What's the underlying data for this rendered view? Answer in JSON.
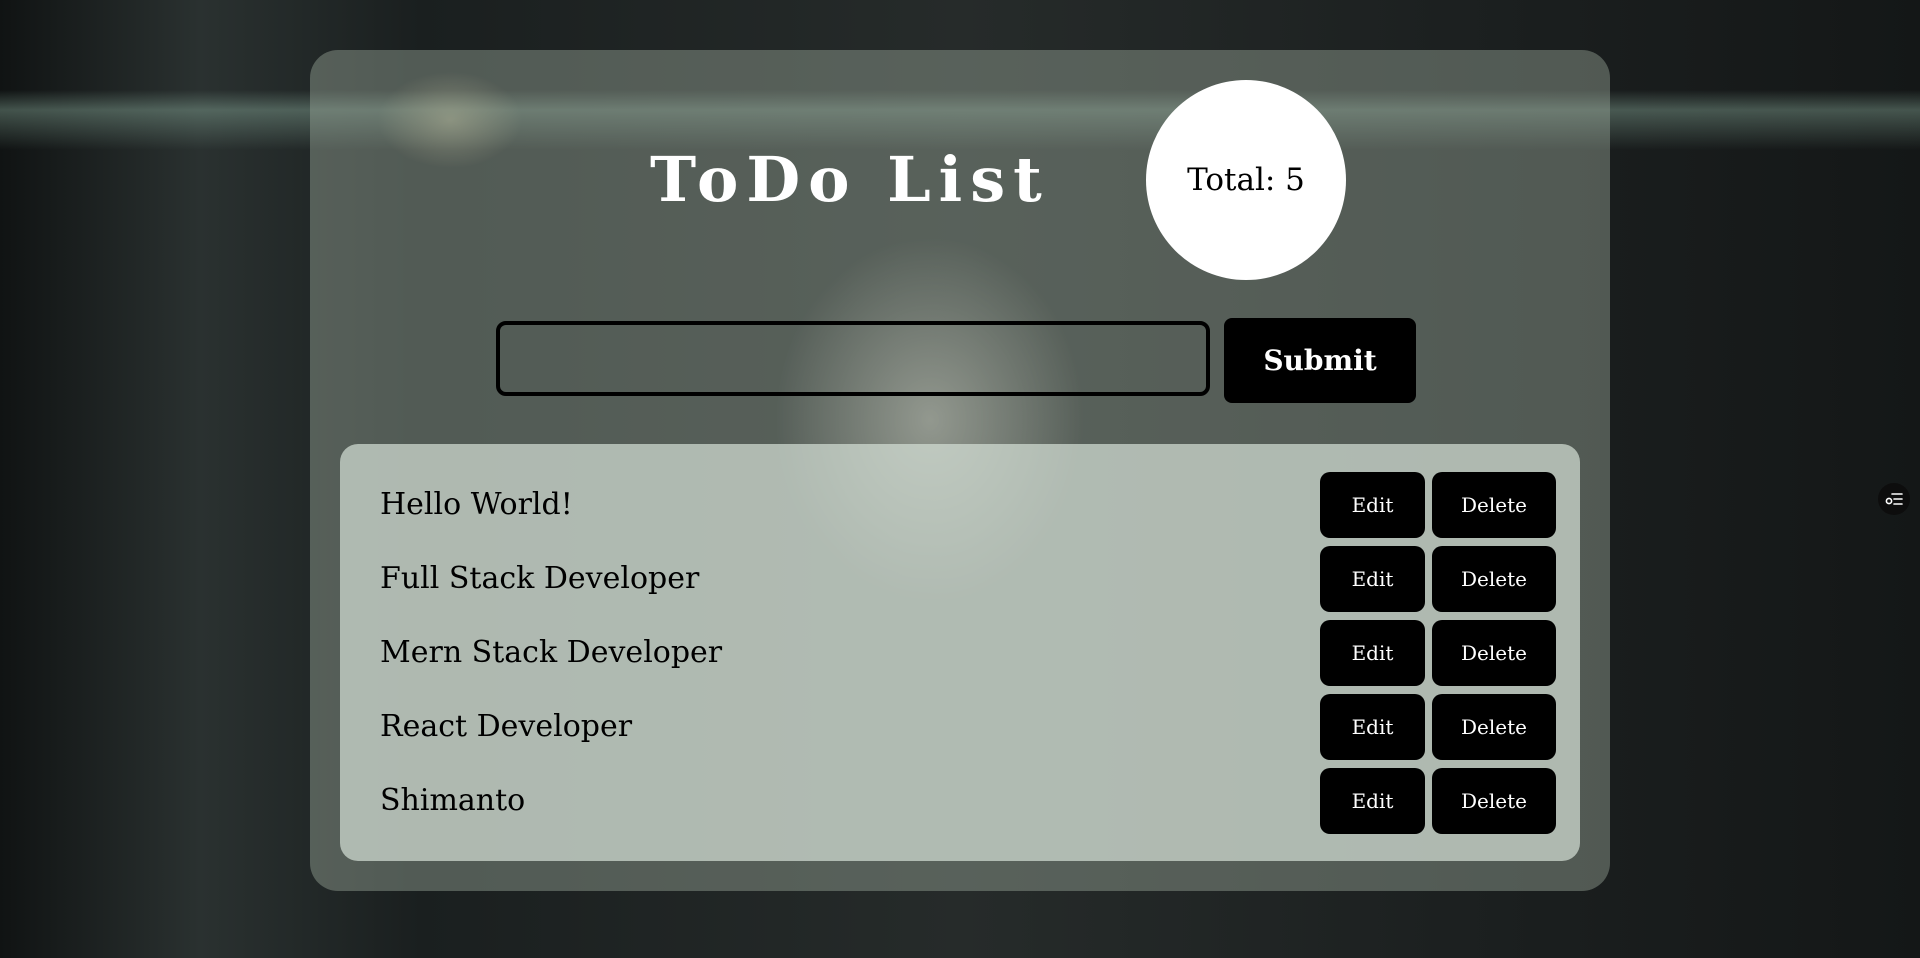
{
  "app": {
    "title": "ToDo List",
    "total_label": "Total: 5"
  },
  "form": {
    "input_value": "",
    "input_placeholder": "",
    "submit_label": "Submit"
  },
  "todos": [
    {
      "text": "Hello World!",
      "edit_label": "Edit",
      "delete_label": "Delete"
    },
    {
      "text": "Full Stack Developer",
      "edit_label": "Edit",
      "delete_label": "Delete"
    },
    {
      "text": "Mern Stack Developer",
      "edit_label": "Edit",
      "delete_label": "Delete"
    },
    {
      "text": "React Developer",
      "edit_label": "Edit",
      "delete_label": "Delete"
    },
    {
      "text": "Shimanto",
      "edit_label": "Edit",
      "delete_label": "Delete"
    }
  ],
  "icons": {
    "side_widget": "tasks-settings-icon"
  },
  "colors": {
    "title_text": "#ffffff",
    "button_bg": "#000000",
    "button_text": "#ffffff",
    "counter_bg": "#ffffff"
  }
}
